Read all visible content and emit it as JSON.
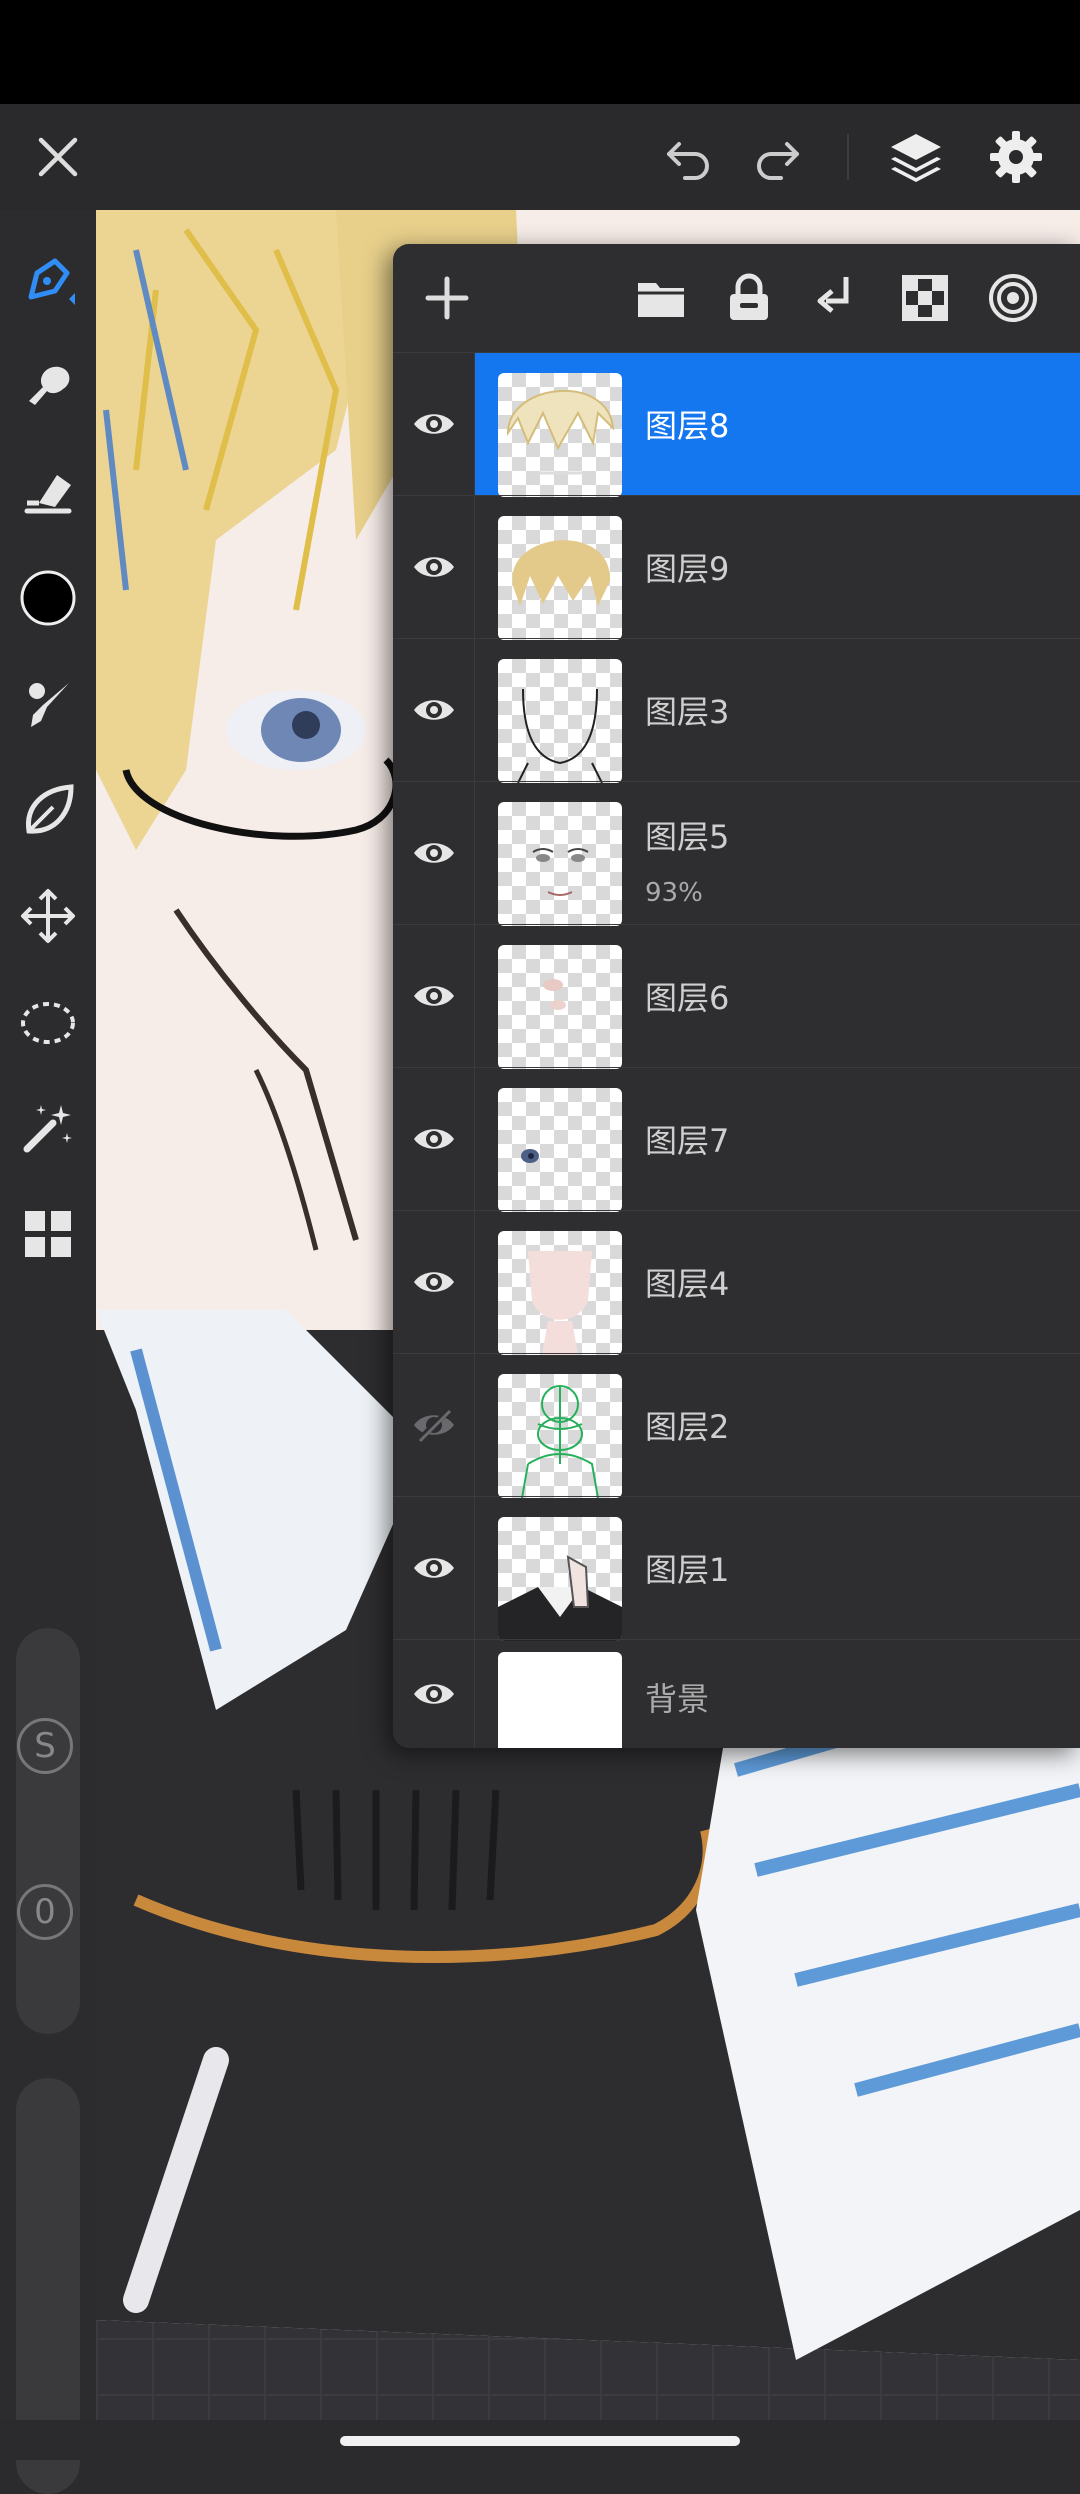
{
  "toolbar": {
    "close": "close-icon",
    "undo": "undo-icon",
    "redo": "redo-icon",
    "layers": "layers-icon",
    "settings": "gear-icon"
  },
  "tools": [
    "pen",
    "smudge",
    "eraser",
    "color",
    "brush-settings",
    "lasso-fill",
    "transform",
    "selection",
    "magic-wand",
    "gallery"
  ],
  "sliders": {
    "size_button": "S",
    "opacity_button": "0"
  },
  "layers_panel": {
    "header_icons": [
      "plus-icon",
      "folder-icon",
      "lock-icon",
      "merge-down-icon",
      "checker-icon",
      "blend-icon"
    ],
    "layers": [
      {
        "name": "图层8",
        "visible": true,
        "selected": true,
        "opacity": ""
      },
      {
        "name": "图层9",
        "visible": true,
        "selected": false,
        "opacity": ""
      },
      {
        "name": "图层3",
        "visible": true,
        "selected": false,
        "opacity": ""
      },
      {
        "name": "图层5",
        "visible": true,
        "selected": false,
        "opacity": "93%"
      },
      {
        "name": "图层6",
        "visible": true,
        "selected": false,
        "opacity": ""
      },
      {
        "name": "图层7",
        "visible": true,
        "selected": false,
        "opacity": ""
      },
      {
        "name": "图层4",
        "visible": true,
        "selected": false,
        "opacity": ""
      },
      {
        "name": "图层2",
        "visible": false,
        "selected": false,
        "opacity": ""
      },
      {
        "name": "图层1",
        "visible": true,
        "selected": false,
        "opacity": ""
      },
      {
        "name": "背景",
        "visible": true,
        "selected": false,
        "opacity": ""
      }
    ]
  },
  "colors": {
    "accent": "#1577ef",
    "current_color": "#000000",
    "panel_bg": "#2e2e30"
  }
}
